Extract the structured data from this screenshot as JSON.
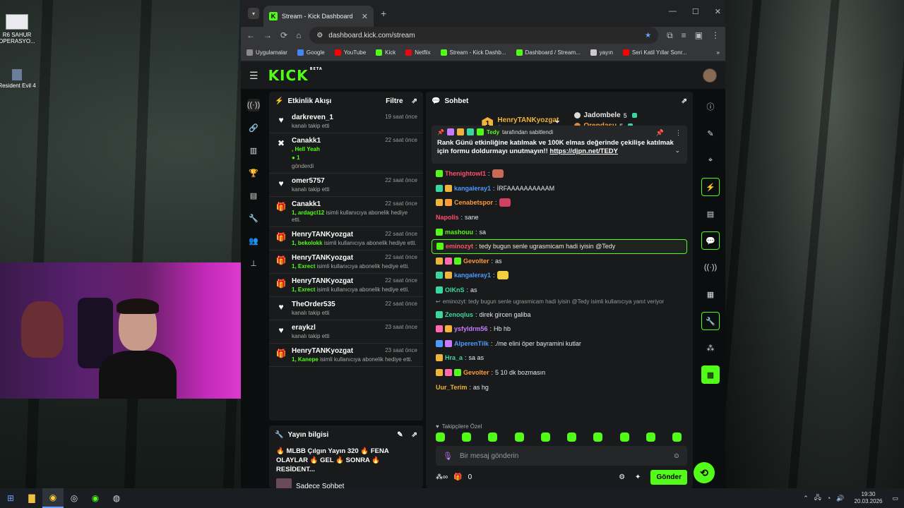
{
  "desktop": {
    "icons": [
      {
        "label": "R6 SAHUR OPERASYO..."
      },
      {
        "label": "Resident Evil 4"
      }
    ]
  },
  "browser": {
    "tab_title": "Stream - Kick Dashboard",
    "url": "dashboard.kick.com/stream",
    "bookmarks": [
      {
        "label": "Uygulamalar",
        "color": "#8a8a8a"
      },
      {
        "label": "Google",
        "color": "#4285f4"
      },
      {
        "label": "YouTube",
        "color": "#ff0000"
      },
      {
        "label": "Kick",
        "color": "#53fc18"
      },
      {
        "label": "Netflix",
        "color": "#e50914"
      },
      {
        "label": "Stream - Kick Dashb...",
        "color": "#53fc18"
      },
      {
        "label": "Dashboard / Stream...",
        "color": "#53fc18"
      },
      {
        "label": "yayın",
        "color": "#cccccc"
      },
      {
        "label": "Seri Katil Yıllar Sonr...",
        "color": "#ff0000"
      }
    ]
  },
  "kick": {
    "logo": "KICK",
    "logo_sup": "BETA",
    "activity": {
      "title": "Etkinlik Akışı",
      "filter": "Filtre",
      "items": [
        {
          "icon": "heart",
          "name": "darkreven_1",
          "time": "19 saat önce",
          "desc": "kanalı takip etti",
          "hl": ""
        },
        {
          "icon": "x",
          "name": "Canakk1",
          "time": "22 saat önce",
          "hl": ", Hell Yeah",
          "extra": "1",
          "desc": "gönderdi"
        },
        {
          "icon": "heart",
          "name": "omer5757",
          "time": "22 saat önce",
          "desc": "kanalı takip etti",
          "hl": ""
        },
        {
          "icon": "gift",
          "name": "Canakk1",
          "time": "22 saat önce",
          "hl": "1, ardagcl12",
          "desc": "isimli kullanıcıya abonelik hediye etti."
        },
        {
          "icon": "gift",
          "name": "HenryTANKyozgat",
          "time": "22 saat önce",
          "hl": "1, bekolokk",
          "desc": "isimli kullanıcıya abonelik hediye etti."
        },
        {
          "icon": "gift",
          "name": "HenryTANKyozgat",
          "time": "22 saat önce",
          "hl": "1, Exrect",
          "desc": "isimli kullanıcıya abonelik hediye etti."
        },
        {
          "icon": "gift",
          "name": "HenryTANKyozgat",
          "time": "22 saat önce",
          "hl": "1, Exrect",
          "desc": "isimli kullanıcıya abonelik hediye etti."
        },
        {
          "icon": "heart",
          "name": "TheOrder535",
          "time": "22 saat önce",
          "desc": "kanalı takip etti",
          "hl": ""
        },
        {
          "icon": "heart",
          "name": "eraykzl",
          "time": "23 saat önce",
          "desc": "kanalı takip etti",
          "hl": ""
        },
        {
          "icon": "gift",
          "name": "HenryTANKyozgat",
          "time": "23 saat önce",
          "hl": "1, Kanepe",
          "desc": "isimli kullanıcıya abonelik hediye etti."
        }
      ]
    },
    "stream_info": {
      "title": "Yayın bilgisi",
      "stream_title": "🔥 MLBB Çılgın Yayın 320 🔥 FENA OLAYLAR 🔥 GEL 🔥 SONRA 🔥 RESİDENT...",
      "category": "Sadece Sohbet"
    },
    "chat": {
      "title": "Sohbet",
      "leaders": {
        "first": {
          "rank": "1",
          "name": "HenryTANKyozgat",
          "score": "6"
        },
        "second": {
          "name": "Jadombele",
          "score": "5"
        },
        "third": {
          "name": "Orendasu",
          "score": "5"
        }
      },
      "pinned": {
        "by_name": "Tedy",
        "by_label": "tarafından sabitlendi",
        "text": "Rank Günü etkinliğine katılmak ve 100K elmas değerinde çekilişe katılmak için formu doldurmayı unutmayın!!",
        "link": "https://djpn.net/TEDY"
      },
      "messages": [
        {
          "user": "Thenightowl1",
          "color": "#ff4d6d",
          "text": "",
          "badges": [
            "#53fc18"
          ],
          "emote": "#c86a5a"
        },
        {
          "user": "kangaleray1",
          "color": "#4d9bff",
          "text": "İRFAAAAAAAAAAM",
          "badges": [
            "#3ad7a0",
            "#f0b43a"
          ],
          "emote": ""
        },
        {
          "user": "Cenabetspor",
          "color": "#ff9a3c",
          "text": "",
          "badges": [
            "#f0b43a",
            "#ff9a3c"
          ],
          "emote": "#d04060"
        },
        {
          "user": "Napolis",
          "color": "#ff4d6d",
          "text": "sane",
          "badges": [],
          "emote": ""
        },
        {
          "user": "mashouu",
          "color": "#53fc18",
          "text": "sa",
          "badges": [
            "#53fc18"
          ],
          "emote": ""
        },
        {
          "user": "eminozyt",
          "color": "#ff4d6d",
          "text": "tedy bugun senle ugrasmicam hadi iyisin @Tedy",
          "badges": [
            "#53fc18"
          ],
          "emote": "",
          "highlight": true
        },
        {
          "user": "Gevolter",
          "color": "#ff9a3c",
          "text": "as",
          "badges": [
            "#f0b43a",
            "#ff6ab0",
            "#53fc18"
          ],
          "emote": ""
        },
        {
          "user": "kangaleray1",
          "color": "#4d9bff",
          "text": "",
          "badges": [
            "#3ad7a0",
            "#f0b43a"
          ],
          "emote": "#f0d040"
        },
        {
          "user": "OlKnS",
          "color": "#3ad7a0",
          "text": "as",
          "badges": [
            "#3ad7a0"
          ],
          "emote": ""
        }
      ],
      "reply": "eminozyt: tedy bugun senle ugrasmicam hadi iyisin @Tedy isimli kullanıcıya yanıt veriyor",
      "messages2": [
        {
          "user": "Zenoqlus",
          "color": "#3ad7a0",
          "text": "direk gircen galiba",
          "badges": [
            "#3ad7a0"
          ],
          "emote": ""
        },
        {
          "user": "ysfyldrm56",
          "color": "#c97bff",
          "text": "Hb hb",
          "badges": [
            "#ff6ab0",
            "#f0b43a"
          ],
          "emote": ""
        },
        {
          "user": "AlperenTilk",
          "color": "#4d9bff",
          "text": "./me elini öper bayramini kutlar",
          "badges": [
            "#4d9bff",
            "#c97bff"
          ],
          "emote": ""
        },
        {
          "user": "Hra_a",
          "color": "#3ad7a0",
          "text": "sa as",
          "badges": [
            "#f0b43a"
          ],
          "emote": ""
        },
        {
          "user": "Gevolter",
          "color": "#ff9a3c",
          "text": "5 10 dk bozmasın",
          "badges": [
            "#f0b43a",
            "#ff6ab0",
            "#53fc18"
          ],
          "emote": ""
        },
        {
          "user": "Uur_Terim",
          "color": "#f0b43a",
          "text": "as hg",
          "badges": [],
          "emote": ""
        }
      ],
      "followers_only": "Takipçilere Özel",
      "input_placeholder": "Bir mesaj gönderin",
      "points": "0",
      "send": "Gönder"
    }
  },
  "taskbar": {
    "time": "19:30",
    "date": "20.03.2026"
  }
}
